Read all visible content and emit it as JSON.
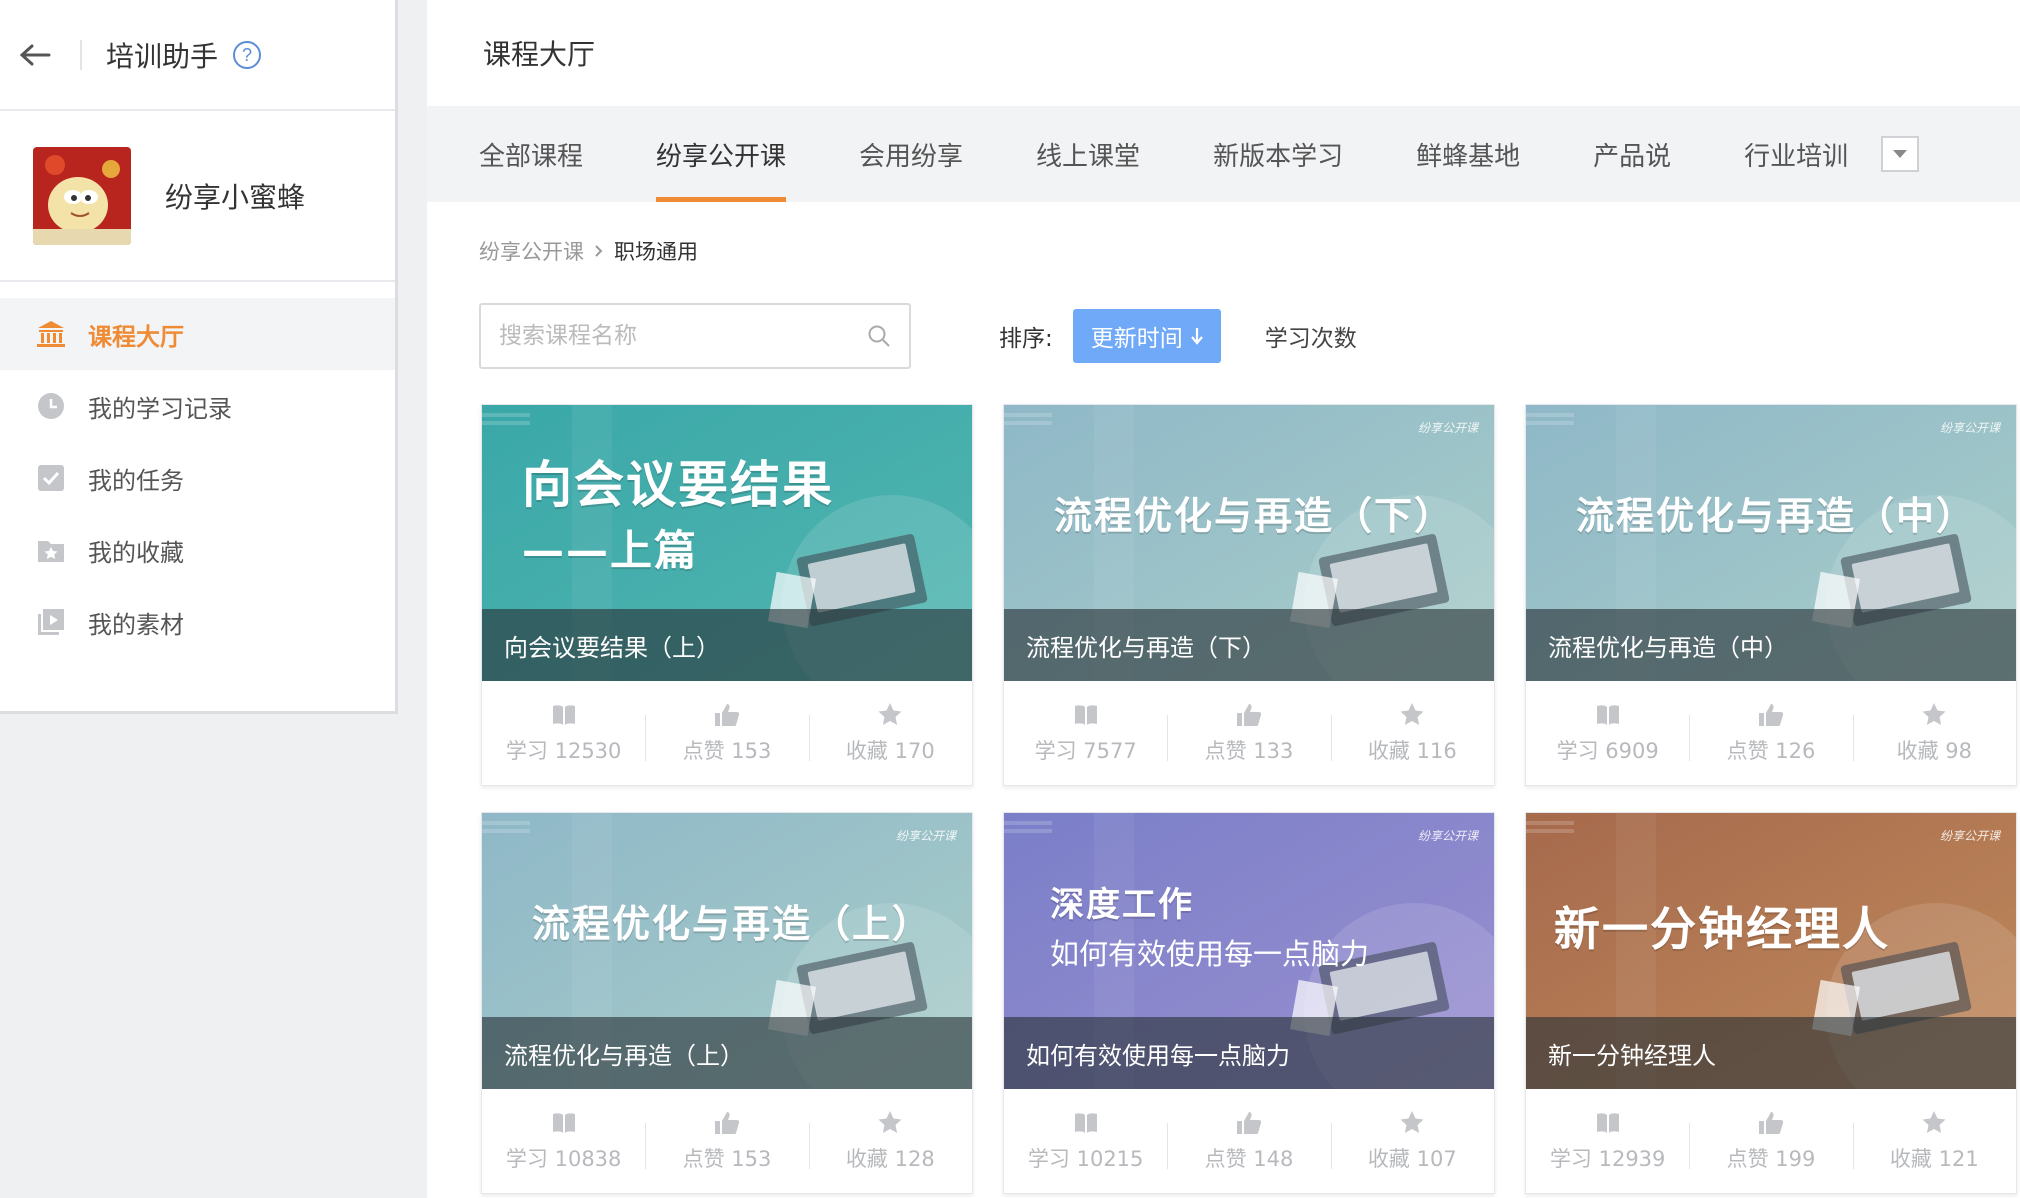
{
  "sidebar": {
    "title": "培训助手",
    "profile_name": "纷享小蜜蜂",
    "nav": [
      {
        "label": "课程大厅",
        "icon": "building-icon",
        "active": true
      },
      {
        "label": "我的学习记录",
        "icon": "clock-icon"
      },
      {
        "label": "我的任务",
        "icon": "checkbox-icon"
      },
      {
        "label": "我的收藏",
        "icon": "star-folder-icon"
      },
      {
        "label": "我的素材",
        "icon": "media-icon"
      }
    ]
  },
  "main": {
    "header_title": "课程大厅",
    "tabs": [
      "全部课程",
      "纷享公开课",
      "会用纷享",
      "线上课堂",
      "新版本学习",
      "鲜蜂基地",
      "产品说",
      "行业培训"
    ],
    "active_tab": "纷享公开课",
    "breadcrumb": {
      "parent": "纷享公开课",
      "current": "职场通用"
    },
    "search_placeholder": "搜索课程名称",
    "sort_label": "排序:",
    "sort_active": "更新时间",
    "sort_other": "学习次数",
    "stat_labels": {
      "study": "学习",
      "like": "点赞",
      "fav": "收藏"
    },
    "courses": [
      {
        "caption": "向会议要结果（上）",
        "cover_title": "向会议要结果",
        "cover_sub": "——上篇",
        "brand": "",
        "study": "12530",
        "like": "153",
        "fav": "170",
        "color1": "#3aa8a8",
        "color2": "#52b5b0"
      },
      {
        "caption": "流程优化与再造（下）",
        "cover_title": "流程优化与再造（下）",
        "cover_sub": "",
        "brand": "纷享公开课",
        "study": "7577",
        "like": "133",
        "fav": "116",
        "color1": "#8fb8c8",
        "color2": "#a8cdc8"
      },
      {
        "caption": "流程优化与再造（中）",
        "cover_title": "流程优化与再造（中）",
        "cover_sub": "",
        "brand": "纷享公开课",
        "study": "6909",
        "like": "126",
        "fav": "98",
        "color1": "#8fb8c8",
        "color2": "#a8cdc8"
      },
      {
        "caption": "流程优化与再造（上）",
        "cover_title": "流程优化与再造（上）",
        "cover_sub": "",
        "brand": "纷享公开课",
        "study": "10838",
        "like": "153",
        "fav": "128",
        "color1": "#8fb8c8",
        "color2": "#a8cdc8"
      },
      {
        "caption": "如何有效使用每一点脑力",
        "cover_title": "深度工作",
        "cover_sub": "如何有效使用每一点脑力",
        "brand": "纷享公开课",
        "study": "10215",
        "like": "148",
        "fav": "107",
        "color1": "#7a7fc8",
        "color2": "#9a8fd0"
      },
      {
        "caption": "新一分钟经理人",
        "cover_title": "新一分钟经理人",
        "cover_sub": "",
        "brand": "纷享公开课",
        "study": "12939",
        "like": "199",
        "fav": "121",
        "color1": "#a66a4c",
        "color2": "#c08a5c"
      }
    ]
  },
  "colors": {
    "accent": "#ef8b34",
    "sort_button": "#6fa9f7"
  }
}
